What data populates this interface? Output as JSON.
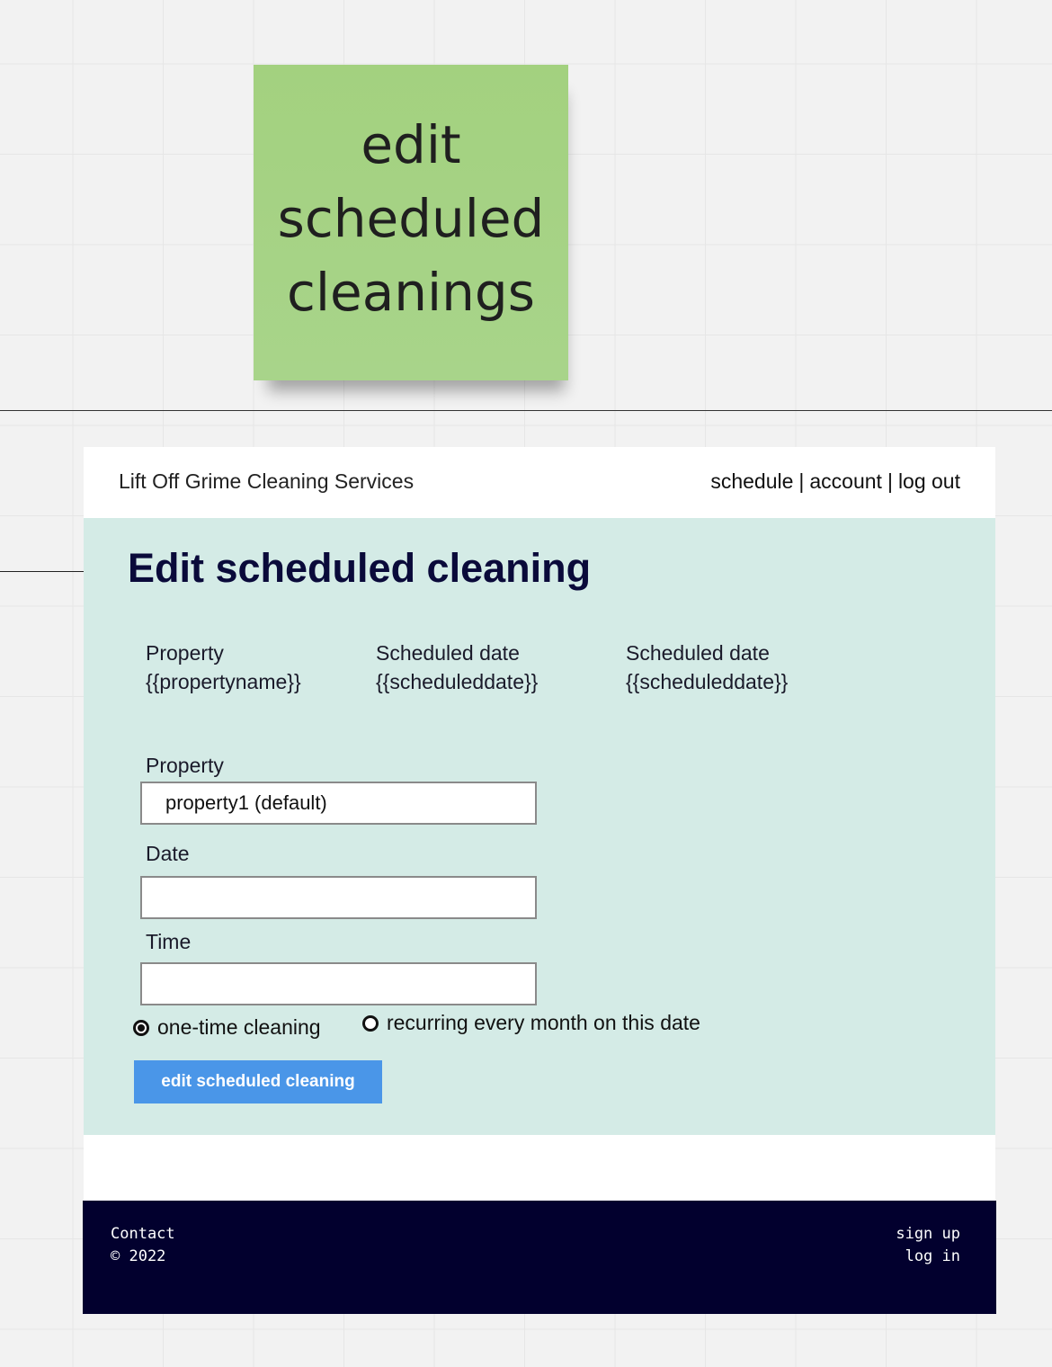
{
  "sticky_note": {
    "text": "edit\nscheduled\ncleanings"
  },
  "header": {
    "brand": "Lift Off Grime Cleaning Services",
    "nav": [
      {
        "label": "schedule"
      },
      {
        "label": "account"
      },
      {
        "label": "log out"
      }
    ],
    "separator": "|"
  },
  "main": {
    "title": "Edit scheduled cleaning",
    "summary": [
      {
        "label": "Property",
        "value": "{{propertyname}}"
      },
      {
        "label": "Scheduled date",
        "value": "{{scheduleddate}}"
      },
      {
        "label": "Scheduled date",
        "value": "{{scheduleddate}}"
      }
    ],
    "form": {
      "property_label": "Property",
      "property_value": "property1 (default)",
      "date_label": "Date",
      "date_value": "",
      "time_label": "Time",
      "time_value": "",
      "radio_options": [
        {
          "label": "one-time cleaning",
          "selected": true
        },
        {
          "label": "recurring every month on this date",
          "selected": false
        }
      ],
      "submit_label": "edit scheduled cleaning"
    }
  },
  "footer": {
    "contact": "Contact",
    "copyright": "© 2022",
    "sign_up": "sign up",
    "log_in": "log in"
  },
  "colors": {
    "sticky": "#a3d17f",
    "main_bg": "#d4ebe6",
    "button": "#4a96e8",
    "footer_bg": "#02002e",
    "title": "#0a0a3a"
  }
}
